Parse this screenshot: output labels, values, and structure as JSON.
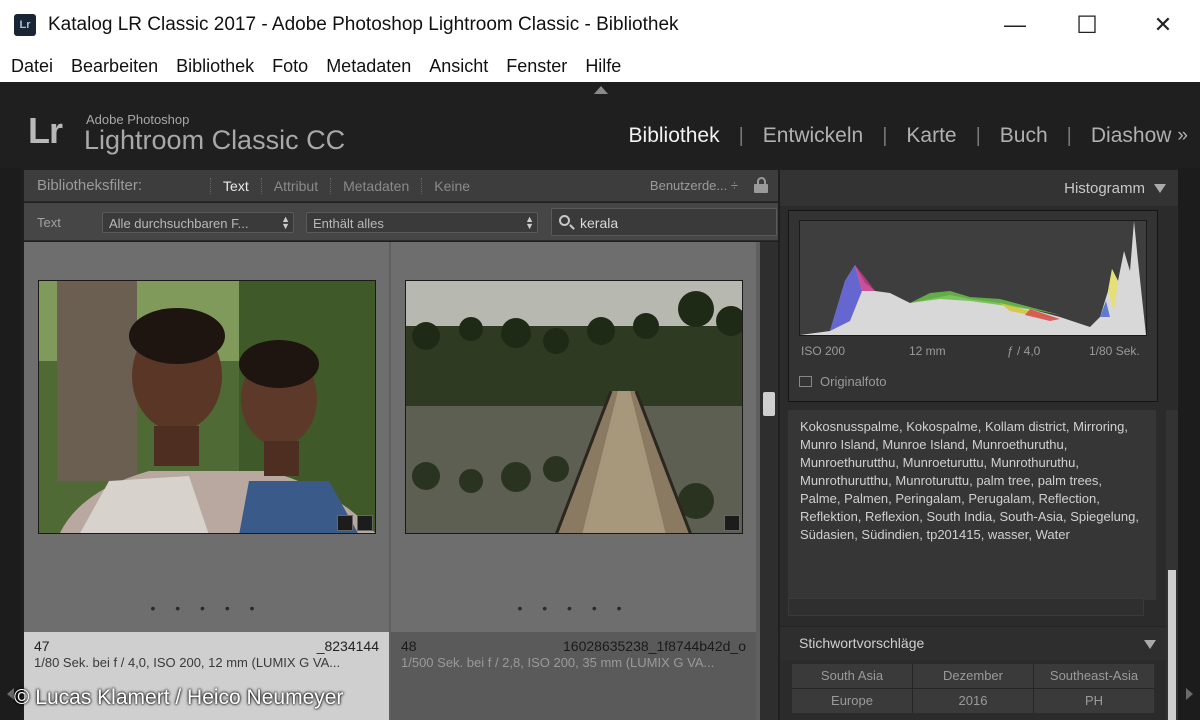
{
  "window": {
    "title": "Katalog LR Classic 2017 - Adobe Photoshop Lightroom Classic - Bibliothek",
    "app_icon": "Lr",
    "controls": {
      "minimize": "—",
      "maximize": "☐",
      "close": "✕"
    }
  },
  "menu": [
    "Datei",
    "Bearbeiten",
    "Bibliothek",
    "Foto",
    "Metadaten",
    "Ansicht",
    "Fenster",
    "Hilfe"
  ],
  "identity": {
    "logo": "Lr",
    "product_small": "Adobe Photoshop",
    "product_big": "Lightroom Classic CC"
  },
  "modules": [
    {
      "label": "Bibliothek",
      "active": true
    },
    {
      "label": "Entwickeln",
      "active": false
    },
    {
      "label": "Karte",
      "active": false
    },
    {
      "label": "Buch",
      "active": false
    },
    {
      "label": "Diashow",
      "active": false
    }
  ],
  "modules_more": "»",
  "filter": {
    "label": "Bibliotheksfilter:",
    "tabs": [
      "Text",
      "Attribut",
      "Metadaten",
      "Keine"
    ],
    "active_tab": "Text",
    "preset": "Benutzerde... ÷",
    "text_row": {
      "label": "Text",
      "field_dropdown": "Alle durchsuchbaren F...",
      "rule_dropdown": "Enthält alles",
      "query": "kerala"
    }
  },
  "grid": {
    "cells": [
      {
        "index": "47",
        "filename": "_8234144",
        "exif": "1/80 Sek. bei f / 4,0, ISO 200, 12 mm (LUMIX G VA...",
        "selected": true
      },
      {
        "index": "48",
        "filename": "16028635238_1f8744b42d_o",
        "exif": "1/500 Sek. bei f / 2,8, ISO 200, 35 mm (LUMIX G VA...",
        "selected": false
      }
    ],
    "dots": "• • • • •"
  },
  "histogram": {
    "title": "Histogramm",
    "iso": "ISO 200",
    "focal": "12 mm",
    "aperture": "ƒ / 4,0",
    "shutter": "1/80 Sek.",
    "original_photo_label": "Originalfoto"
  },
  "keywords": {
    "text": "Kokosnusspalme, Kokospalme, Kollam district, Mirroring, Munro Island, Munroe Island, Munroethuruthu, Munroethurutthu, Munroeturuttu, Munrothuruthu, Munrothurutthu, Munroturuttu, palm tree, palm trees, Palme, Palmen, Peringalam, Perugalam, Reflection, Reflektion, Reflexion, South India, South-Asia, Spiegelung, Südasien, Südindien, tp201415, wasser, Water"
  },
  "suggestions": {
    "title": "Stichwortvorschläge",
    "items": [
      "South Asia",
      "Dezember",
      "Southeast-Asia",
      "Europe",
      "2016",
      "PH"
    ]
  },
  "credit": "© Lucas Klamert / Heico Neumeyer"
}
